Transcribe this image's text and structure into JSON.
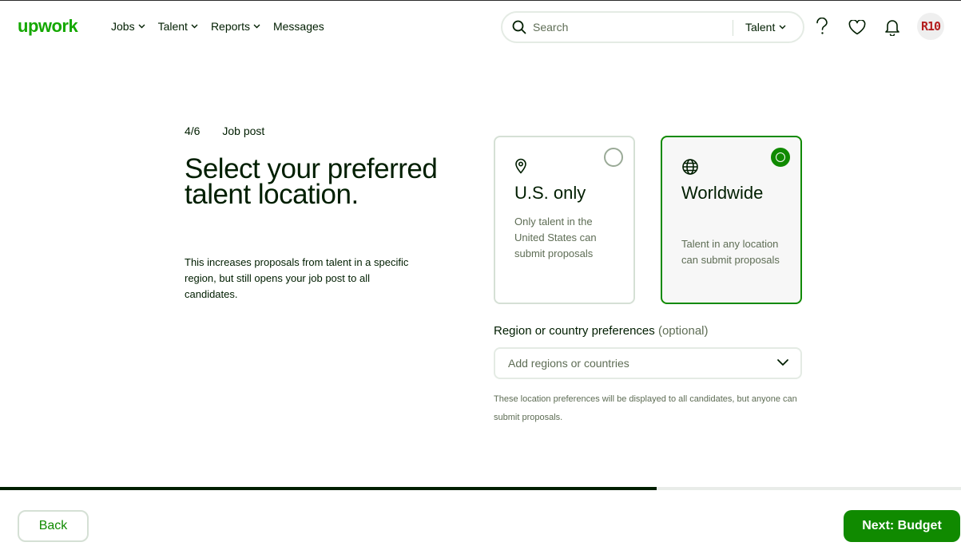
{
  "header": {
    "logo": "upwork",
    "nav": [
      {
        "label": "Jobs",
        "has_dropdown": true
      },
      {
        "label": "Talent",
        "has_dropdown": true
      },
      {
        "label": "Reports",
        "has_dropdown": true
      },
      {
        "label": "Messages",
        "has_dropdown": false
      }
    ],
    "search": {
      "placeholder": "Search",
      "scope": "Talent"
    },
    "icons": [
      "help-icon",
      "heart-icon",
      "bell-icon"
    ],
    "avatar_text": "R10"
  },
  "step": {
    "counter": "4/6",
    "label": "Job post"
  },
  "title": "Select your preferred talent location.",
  "description": "This increases proposals from talent in a specific region, but still opens your job post to all candidates.",
  "options": [
    {
      "title": "U.S. only",
      "text": "Only talent in the United States can submit proposals",
      "icon": "location-pin-icon",
      "selected": false
    },
    {
      "title": "Worldwide",
      "text": "Talent in any location can submit proposals",
      "icon": "globe-icon",
      "selected": true
    }
  ],
  "region": {
    "label": "Region or country preferences",
    "optional": "(optional)",
    "placeholder": "Add regions or countries",
    "note": "These location preferences will be displayed to all candidates, but anyone can submit proposals."
  },
  "progress_fraction": 0.683,
  "footer": {
    "back_label": "Back",
    "next_label": "Next: Budget"
  },
  "colors": {
    "brand": "#14a800",
    "accent": "#108a00",
    "text": "#001e00",
    "muted": "#5e6d55"
  }
}
